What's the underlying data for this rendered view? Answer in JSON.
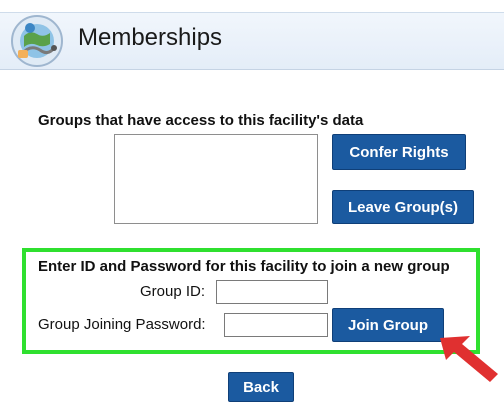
{
  "header": {
    "title": "Memberships",
    "logo_icon": "stethoscope-globe-logo"
  },
  "groups_section": {
    "label": "Groups that have access to this facility's data",
    "items": [],
    "confer_button": "Confer Rights",
    "leave_button": "Leave Group(s)"
  },
  "join_section": {
    "title": "Enter ID and Password for this facility to join a new group",
    "group_id_label": "Group ID:",
    "group_id_value": "",
    "password_label": "Group Joining Password:",
    "password_value": "",
    "join_button": "Join Group",
    "highlight_color": "#2fe02f",
    "pointer_icon": "red-arrow-icon",
    "pointer_color": "#e03030"
  },
  "footer": {
    "back_button": "Back"
  },
  "colors": {
    "button": "#1b5aa0",
    "header_band": "#e8f0fa"
  }
}
